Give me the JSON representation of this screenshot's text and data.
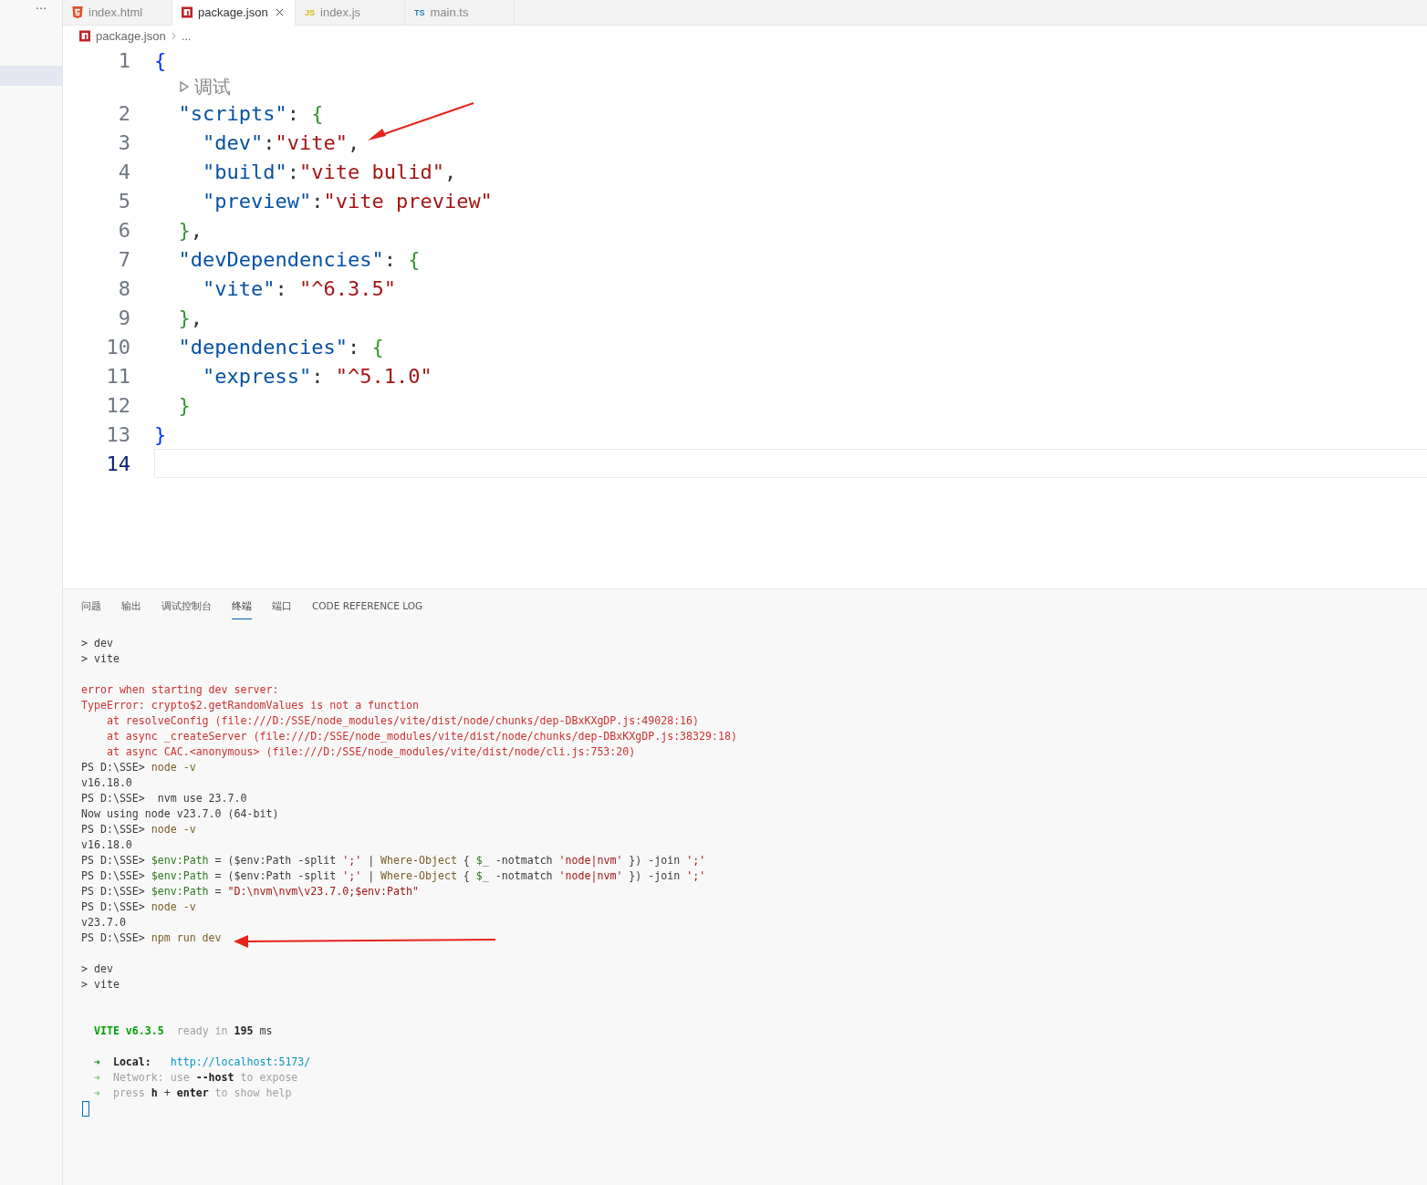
{
  "activity_bar": {
    "more_label": "···"
  },
  "tabs": [
    {
      "label": "index.html",
      "kind": "html",
      "selected": false
    },
    {
      "label": "package.json",
      "kind": "npm",
      "selected": true
    },
    {
      "label": "index.js",
      "kind": "js",
      "badge": "JS",
      "selected": false
    },
    {
      "label": "main.ts",
      "kind": "ts",
      "badge": "TS",
      "selected": false
    }
  ],
  "breadcrumb": {
    "file": "package.json",
    "more": "..."
  },
  "editor": {
    "lines": [
      {
        "number": "1",
        "current": false,
        "segments": [
          {
            "text": "{",
            "kind": "brace"
          }
        ]
      },
      {
        "kind": "codelens",
        "label": "调试"
      },
      {
        "number": "2",
        "current": false,
        "segments": [
          {
            "text": "  \"scripts\"",
            "kind": "key"
          },
          {
            "text": ": ",
            "kind": "punct"
          },
          {
            "text": "{",
            "kind": "brace2"
          }
        ]
      },
      {
        "number": "3",
        "current": false,
        "segments": [
          {
            "text": "    \"dev\"",
            "kind": "key"
          },
          {
            "text": ":",
            "kind": "punct"
          },
          {
            "text": "\"vite\"",
            "kind": "str"
          },
          {
            "text": ",",
            "kind": "punct"
          }
        ]
      },
      {
        "number": "4",
        "current": false,
        "segments": [
          {
            "text": "    \"build\"",
            "kind": "key"
          },
          {
            "text": ":",
            "kind": "punct"
          },
          {
            "text": "\"vite bulid\"",
            "kind": "str"
          },
          {
            "text": ",",
            "kind": "punct"
          }
        ]
      },
      {
        "number": "5",
        "current": false,
        "segments": [
          {
            "text": "    \"preview\"",
            "kind": "key"
          },
          {
            "text": ":",
            "kind": "punct"
          },
          {
            "text": "\"vite preview\"",
            "kind": "str"
          }
        ]
      },
      {
        "number": "6",
        "current": false,
        "segments": [
          {
            "text": "  }",
            "kind": "brace2"
          },
          {
            "text": ",",
            "kind": "punct"
          }
        ]
      },
      {
        "number": "7",
        "current": false,
        "segments": [
          {
            "text": "  \"devDependencies\"",
            "kind": "key"
          },
          {
            "text": ": ",
            "kind": "punct"
          },
          {
            "text": "{",
            "kind": "brace2"
          }
        ]
      },
      {
        "number": "8",
        "current": false,
        "segments": [
          {
            "text": "    \"vite\"",
            "kind": "key"
          },
          {
            "text": ": ",
            "kind": "punct"
          },
          {
            "text": "\"^6.3.5\"",
            "kind": "str"
          }
        ]
      },
      {
        "number": "9",
        "current": false,
        "segments": [
          {
            "text": "  }",
            "kind": "brace2"
          },
          {
            "text": ",",
            "kind": "punct"
          }
        ]
      },
      {
        "number": "10",
        "current": false,
        "segments": [
          {
            "text": "  \"dependencies\"",
            "kind": "key"
          },
          {
            "text": ": ",
            "kind": "punct"
          },
          {
            "text": "{",
            "kind": "brace2"
          }
        ]
      },
      {
        "number": "11",
        "current": false,
        "segments": [
          {
            "text": "    \"express\"",
            "kind": "key"
          },
          {
            "text": ": ",
            "kind": "punct"
          },
          {
            "text": "\"^5.1.0\"",
            "kind": "str"
          }
        ]
      },
      {
        "number": "12",
        "current": false,
        "segments": [
          {
            "text": "  }",
            "kind": "brace2"
          }
        ]
      },
      {
        "number": "13",
        "current": false,
        "segments": [
          {
            "text": "}",
            "kind": "brace"
          }
        ]
      },
      {
        "number": "14",
        "current": true
      }
    ]
  },
  "panel": {
    "tabs": [
      {
        "label": "问题",
        "selected": false
      },
      {
        "label": "输出",
        "selected": false
      },
      {
        "label": "调试控制台",
        "selected": false
      },
      {
        "label": "终端",
        "selected": true
      },
      {
        "label": "端口",
        "selected": false
      },
      {
        "label": "CODE REFERENCE LOG",
        "selected": false
      }
    ],
    "terminal": [
      {
        "kind": "output",
        "lines": [
          {
            "segments": [
              {
                "text": "> dev",
                "kind": "text"
              }
            ]
          },
          {
            "segments": [
              {
                "text": "> vite",
                "kind": "text"
              }
            ]
          }
        ]
      },
      {
        "kind": "output",
        "lines": [
          {
            "segments": [
              {
                "text": "error when starting dev server:",
                "kind": "error"
              }
            ]
          },
          {
            "segments": [
              {
                "text": "TypeError: crypto$2.getRandomValues is not a function",
                "kind": "error"
              }
            ]
          },
          {
            "segments": [
              {
                "text": "    at resolveConfig (file:///D:/SSE/node_modules/vite/dist/node/chunks/dep-DBxKXgDP.js:49028:16)",
                "kind": "error"
              }
            ]
          },
          {
            "segments": [
              {
                "text": "    at async _createServer (file:///D:/SSE/node_modules/vite/dist/node/chunks/dep-DBxKXgDP.js:38329:18)",
                "kind": "error"
              }
            ]
          },
          {
            "segments": [
              {
                "text": "    at async CAC.<anonymous> (file:///D:/SSE/node_modules/vite/dist/node/cli.js:753:20)",
                "kind": "error"
              }
            ]
          },
          {
            "segments": [
              {
                "text": "PS D:\\SSE> ",
                "kind": "text"
              },
              {
                "text": "node -v",
                "kind": "cmd"
              }
            ]
          },
          {
            "segments": [
              {
                "text": "v16.18.0",
                "kind": "text"
              }
            ]
          },
          {
            "segments": [
              {
                "text": "PS D:\\SSE>  nvm use 23.7.0",
                "kind": "text"
              }
            ]
          },
          {
            "segments": [
              {
                "text": "Now using node v23.7.0 (64-bit)",
                "kind": "text"
              }
            ]
          },
          {
            "segments": [
              {
                "text": "PS D:\\SSE> ",
                "kind": "text"
              },
              {
                "text": "node -v",
                "kind": "cmd"
              }
            ]
          },
          {
            "segments": [
              {
                "text": "v16.18.0",
                "kind": "text"
              }
            ]
          },
          {
            "segments": [
              {
                "text": "PS D:\\SSE> ",
                "kind": "text"
              },
              {
                "text": "$env:Path",
                "kind": "var"
              },
              {
                "text": " = ($env:Path -split ",
                "kind": "text"
              },
              {
                "text": "';'",
                "kind": "str"
              },
              {
                "text": " | ",
                "kind": "text"
              },
              {
                "text": "Where-Object",
                "kind": "cmd"
              },
              {
                "text": " { ",
                "kind": "text"
              },
              {
                "text": "$_",
                "kind": "var"
              },
              {
                "text": " -notmatch ",
                "kind": "text"
              },
              {
                "text": "'node|nvm'",
                "kind": "str"
              },
              {
                "text": " }) -join ",
                "kind": "text"
              },
              {
                "text": "';'",
                "kind": "str"
              }
            ]
          },
          {
            "segments": [
              {
                "text": "PS D:\\SSE> ",
                "kind": "text"
              },
              {
                "text": "$env:Path",
                "kind": "var"
              },
              {
                "text": " = ($env:Path -split ",
                "kind": "text"
              },
              {
                "text": "';'",
                "kind": "str"
              },
              {
                "text": " | ",
                "kind": "text"
              },
              {
                "text": "Where-Object",
                "kind": "cmd"
              },
              {
                "text": " { ",
                "kind": "text"
              },
              {
                "text": "$_",
                "kind": "var"
              },
              {
                "text": " -notmatch ",
                "kind": "text"
              },
              {
                "text": "'node|nvm'",
                "kind": "str"
              },
              {
                "text": " }) -join ",
                "kind": "text"
              },
              {
                "text": "';'",
                "kind": "str"
              }
            ]
          },
          {
            "segments": [
              {
                "text": "PS D:\\SSE> ",
                "kind": "text"
              },
              {
                "text": "$env:Path",
                "kind": "var"
              },
              {
                "text": " = ",
                "kind": "text"
              },
              {
                "text": "\"D:\\nvm\\nvm\\v23.7.0;$env:Path\"",
                "kind": "str"
              }
            ]
          },
          {
            "segments": [
              {
                "text": "PS D:\\SSE> ",
                "kind": "text"
              },
              {
                "text": "node -v",
                "kind": "cmd"
              }
            ]
          },
          {
            "segments": [
              {
                "text": "v23.7.0",
                "kind": "text"
              }
            ]
          },
          {
            "segments": [
              {
                "text": "PS D:\\SSE> ",
                "kind": "text"
              },
              {
                "text": "npm run dev",
                "kind": "cmd"
              }
            ]
          }
        ]
      },
      {
        "kind": "output",
        "lines": [
          {
            "segments": [
              {
                "text": "> dev",
                "kind": "text"
              }
            ]
          },
          {
            "segments": [
              {
                "text": "> vite",
                "kind": "text"
              }
            ]
          }
        ]
      },
      {
        "kind": "banner",
        "lines": [
          {
            "segments": [
              {
                "text": "  VITE v6.3.5",
                "kind": "vite"
              },
              {
                "text": "  ready in ",
                "kind": "dim"
              },
              {
                "text": "195",
                "kind": "bold"
              },
              {
                "text": " ms",
                "kind": "text"
              }
            ]
          }
        ]
      },
      {
        "kind": "output",
        "lines": [
          {
            "segments": [
              {
                "text": "  ➜",
                "kind": "arrow"
              },
              {
                "text": "  Local:",
                "kind": "bold"
              },
              {
                "text": "   http://localhost:5173/",
                "kind": "link"
              }
            ]
          },
          {
            "segments": [
              {
                "text": "  ➜",
                "kind": "arrowdim"
              },
              {
                "text": "  Network: use ",
                "kind": "dim"
              },
              {
                "text": "--host",
                "kind": "bold"
              },
              {
                "text": " to expose",
                "kind": "dim"
              }
            ]
          },
          {
            "segments": [
              {
                "text": "  ➜",
                "kind": "arrowdim"
              },
              {
                "text": "  press ",
                "kind": "dim"
              },
              {
                "text": "h",
                "kind": "bold"
              },
              {
                "text": " + ",
                "kind": "text"
              },
              {
                "text": "enter",
                "kind": "bold"
              },
              {
                "text": " to show help",
                "kind": "dim"
              }
            ]
          }
        ]
      }
    ]
  }
}
